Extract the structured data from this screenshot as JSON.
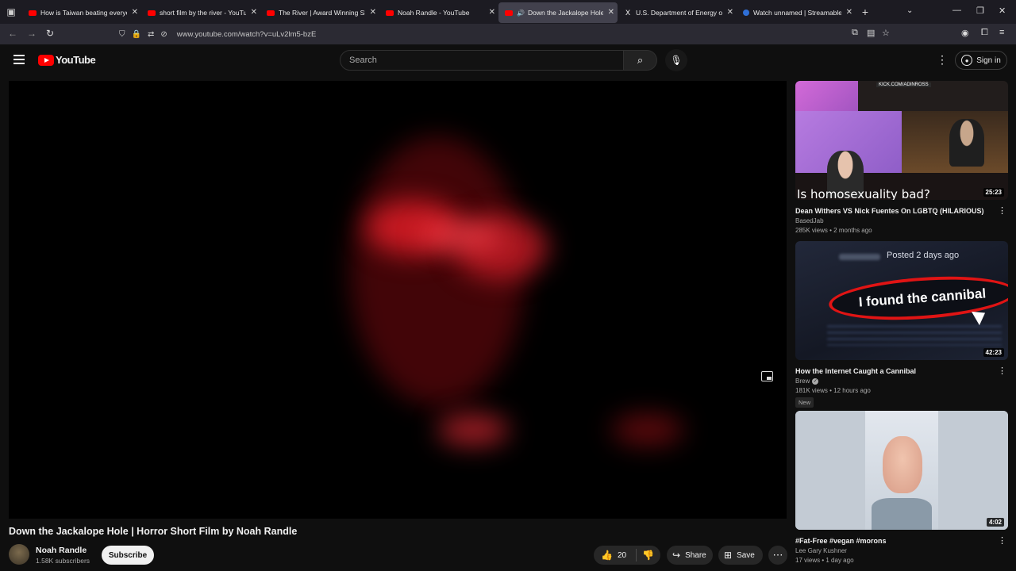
{
  "browser": {
    "tabs": [
      {
        "title": "How is Taiwan beating everyone",
        "fav": "yt",
        "active": false
      },
      {
        "title": "short film by the river - YouTube",
        "fav": "yt",
        "active": false
      },
      {
        "title": "The River | Award Winning Short",
        "fav": "yt",
        "active": false
      },
      {
        "title": "Noah Randle - YouTube",
        "fav": "yt",
        "active": false
      },
      {
        "title": "Down the Jackalope Hole |",
        "fav": "yt",
        "active": true
      },
      {
        "title": "U.S. Department of Energy on X",
        "fav": "x",
        "active": false
      },
      {
        "title": "Watch unnamed | Streamable",
        "fav": "ss",
        "active": false
      }
    ],
    "url": "www.youtube.com/watch?v=uLv2lm5-bzE"
  },
  "header": {
    "logo_text": "YouTube",
    "search_placeholder": "Search",
    "signin_label": "Sign in"
  },
  "video": {
    "title": "Down the Jackalope Hole | Horror Short Film by Noah Randle",
    "channel": "Noah Randle",
    "subscribers": "1.58K subscribers",
    "subscribe_label": "Subscribe",
    "likes": "20",
    "share_label": "Share",
    "save_label": "Save"
  },
  "sidebar": {
    "items": [
      {
        "thumb_caption": "Is homosexuality bad?",
        "thumb_label": "KICK.COM/ADINROSS",
        "duration": "25:23",
        "title": "Dean Withers VS Nick Fuentes On LGBTQ (HILARIOUS)",
        "channel": "BasedJab",
        "meta": "285K views • 2 months ago"
      },
      {
        "thumb_caption": "I found the cannibal",
        "thumb_label": "Posted 2 days ago",
        "duration": "42:23",
        "title": "How the Internet Caught a Cannibal",
        "channel": "Brew",
        "meta": "181K views • 12 hours ago",
        "badge": "New"
      },
      {
        "duration": "4:02",
        "title": "#Fat-Free #vegan #morons",
        "channel": "Lee Gary Kushner",
        "meta": "17 views • 1 day ago"
      }
    ]
  }
}
